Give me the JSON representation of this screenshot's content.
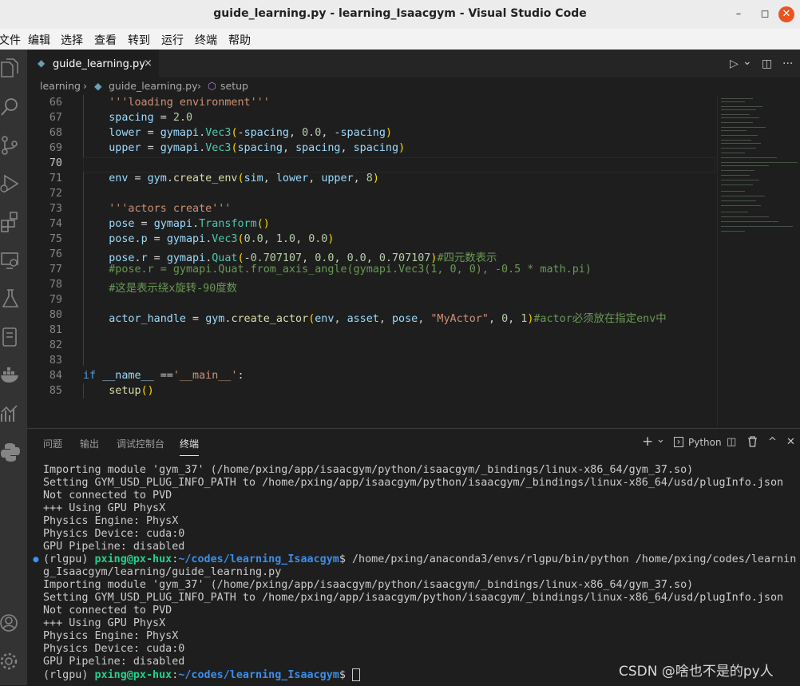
{
  "window": {
    "title": "guide_learning.py - learning_Isaacgym - Visual Studio Code",
    "minimize": "–",
    "maximize": "◻",
    "close": "✕"
  },
  "menu": [
    "文件",
    "编辑",
    "选择",
    "查看",
    "转到",
    "运行",
    "终端",
    "帮助"
  ],
  "activity_icons": [
    "explorer-icon",
    "search-icon",
    "source-control-icon",
    "run-debug-icon",
    "extensions-icon",
    "remote-explorer-icon",
    "testing-icon",
    "notebook-icon",
    "docker-icon",
    "charts-icon",
    "python-icon",
    "account-icon",
    "manage-icon"
  ],
  "tab": {
    "icon": "python-file-icon",
    "label": "guide_learning.py",
    "close": "×"
  },
  "tab_actions": {
    "run": "▷",
    "run_menu": "⌄",
    "split": "◫",
    "more": "···"
  },
  "breadcrumb": {
    "folder": "learning",
    "sep": "›",
    "file": "guide_learning.py",
    "symbol": "setup"
  },
  "editor": {
    "current_line": "70",
    "lines": [
      {
        "n": "66",
        "t": "    '''loading environment'''"
      },
      {
        "n": "67",
        "t": "    spacing = 2.0"
      },
      {
        "n": "68",
        "t": "    lower = gymapi.Vec3(-spacing, 0.0, -spacing)"
      },
      {
        "n": "69",
        "t": "    upper = gymapi.Vec3(spacing, spacing, spacing)"
      },
      {
        "n": "70",
        "t": ""
      },
      {
        "n": "71",
        "t": "    env = gym.create_env(sim, lower, upper, 8)"
      },
      {
        "n": "72",
        "t": ""
      },
      {
        "n": "73",
        "t": "    '''actors create'''"
      },
      {
        "n": "74",
        "t": "    pose = gymapi.Transform()"
      },
      {
        "n": "75",
        "t": "    pose.p = gymapi.Vec3(0.0, 1.0, 0.0)"
      },
      {
        "n": "76",
        "t": "    pose.r = gymapi.Quat(-0.707107, 0.0, 0.0, 0.707107)#四元数表示"
      },
      {
        "n": "77",
        "t": "    #pose.r = gymapi.Quat.from_axis_angle(gymapi.Vec3(1, 0, 0), -0.5 * math.pi)"
      },
      {
        "n": "78",
        "t": "    #这是表示绕x旋转-90度数"
      },
      {
        "n": "79",
        "t": ""
      },
      {
        "n": "80",
        "t": "    actor_handle = gym.create_actor(env, asset, pose, \"MyActor\", 0, 1)#actor必须放在指定env中"
      },
      {
        "n": "81",
        "t": ""
      },
      {
        "n": "82",
        "t": ""
      },
      {
        "n": "83",
        "t": ""
      },
      {
        "n": "84",
        "t": "if __name__ =='__main__':"
      },
      {
        "n": "85",
        "t": "    setup()"
      }
    ]
  },
  "panel": {
    "tabs": [
      "问题",
      "输出",
      "调试控制台",
      "终端"
    ],
    "active_tab": "终端",
    "actions": {
      "add": "+",
      "add_menu": "⌄",
      "shell_icon": "terminal-icon",
      "shell": "Python",
      "split": "◫",
      "trash": "trash-icon",
      "maximize": "^",
      "close": "✕"
    }
  },
  "terminal": {
    "lines": [
      "Importing module 'gym_37' (/home/pxing/app/isaacgym/python/isaacgym/_bindings/linux-x86_64/gym_37.so)",
      "Setting GYM_USD_PLUG_INFO_PATH to /home/pxing/app/isaacgym/python/isaacgym/_bindings/linux-x86_64/usd/plugInfo.json",
      "Not connected to PVD",
      "+++ Using GPU PhysX",
      "Physics Engine: PhysX",
      "Physics Device: cuda:0",
      "GPU Pipeline: disabled"
    ],
    "prompt_env": "(rlgpu) ",
    "prompt_user": "pxing@px-hux",
    "prompt_colon": ":",
    "prompt_path": "~/codes/learning_Isaacgym",
    "prompt_dollar": "$ ",
    "command_1": "/home/pxing/anaconda3/envs/rlgpu/bin/python /home/pxing/codes/learnin",
    "command_2": "g_Isaacgym/learning/guide_learning.py",
    "lines2": [
      "Importing module 'gym_37' (/home/pxing/app/isaacgym/python/isaacgym/_bindings/linux-x86_64/gym_37.so)",
      "Setting GYM_USD_PLUG_INFO_PATH to /home/pxing/app/isaacgym/python/isaacgym/_bindings/linux-x86_64/usd/plugInfo.json",
      "Not connected to PVD",
      "+++ Using GPU PhysX",
      "Physics Engine: PhysX",
      "Physics Device: cuda:0",
      "GPU Pipeline: disabled"
    ]
  },
  "watermark": "CSDN @啥也不是的py人"
}
